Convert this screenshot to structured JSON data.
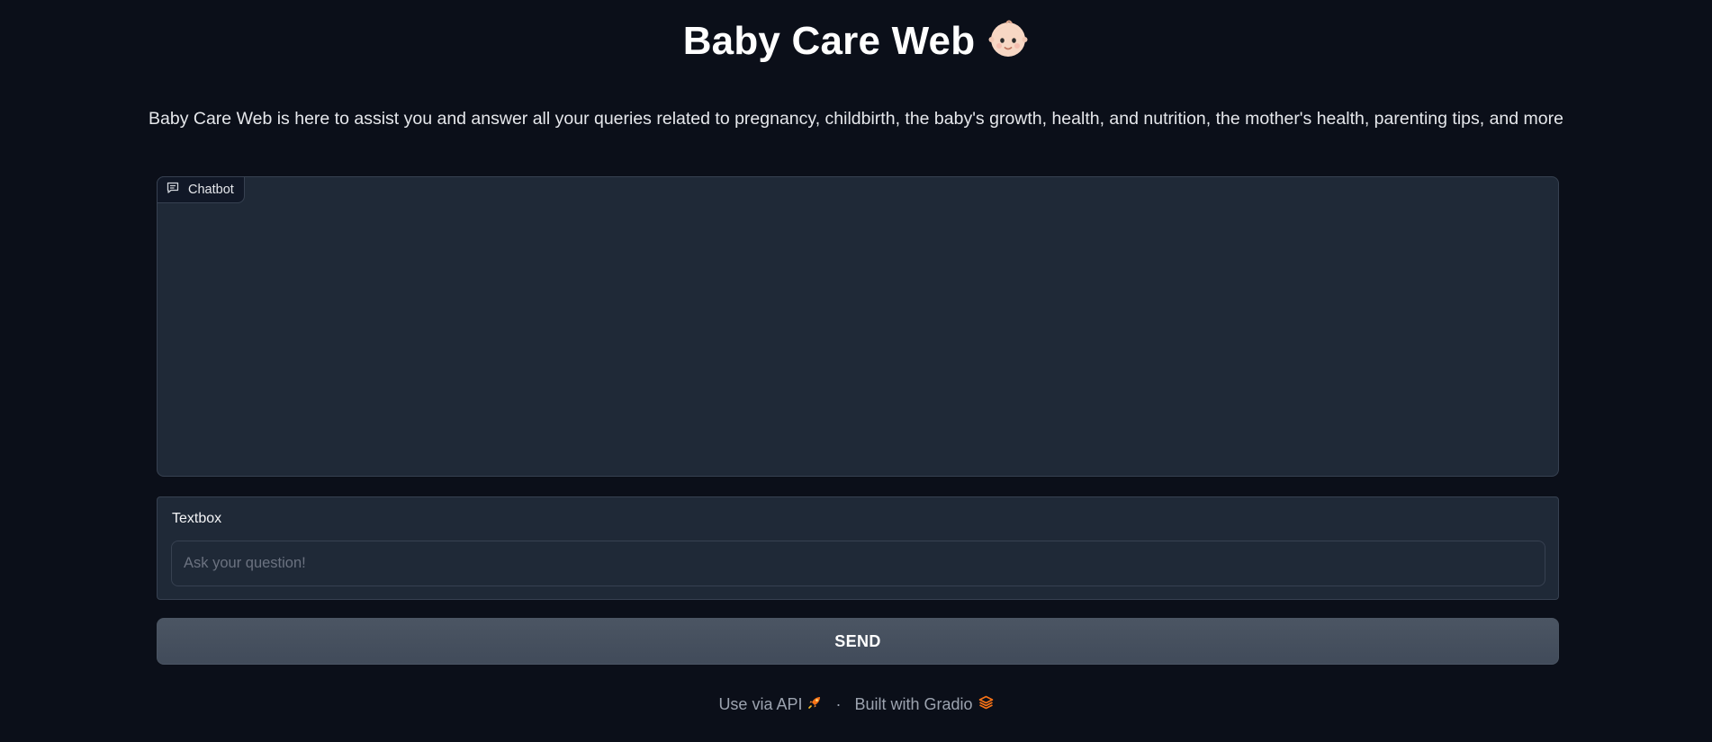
{
  "header": {
    "title": "Baby Care Web",
    "emoji_icon": "baby-face-emoji"
  },
  "description": "Baby Care Web is here to assist you and answer all your queries related to pregnancy, childbirth, the baby's growth, health, and nutrition, the mother's health, parenting tips, and more",
  "chatbot": {
    "label": "Chatbot",
    "icon": "chat-bubble-icon",
    "messages": []
  },
  "textbox": {
    "label": "Textbox",
    "value": "",
    "placeholder": "Ask your question!"
  },
  "send_button": {
    "label": "SEND"
  },
  "footer": {
    "api_link": "Use via API",
    "separator": "·",
    "gradio_link": "Built with Gradio",
    "api_icon": "rocket-icon",
    "gradio_icon": "gradio-logo-icon"
  },
  "colors": {
    "background": "#0b0f19",
    "panel": "#1f2937",
    "border": "#374151",
    "button": "#4b5563",
    "accent_orange": "#f97316"
  }
}
